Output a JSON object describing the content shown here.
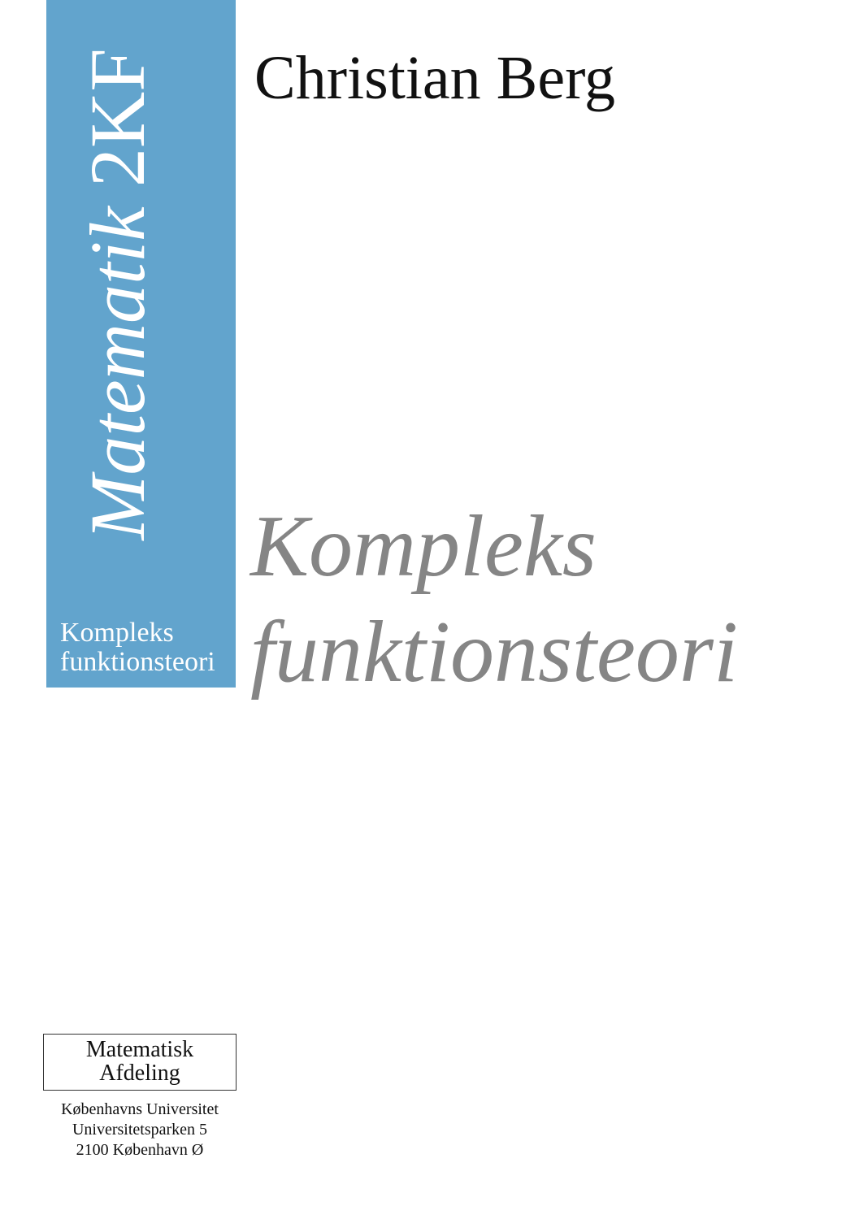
{
  "cover": {
    "series": {
      "italic_part": "Matematik",
      "plain_part": "2KF"
    },
    "band_subtitle": [
      "Kompleks",
      "funktionsteori"
    ],
    "author": "Christian Berg",
    "title": [
      "Kompleks",
      "funktionsteori"
    ],
    "department": [
      "Matematisk",
      "Afdeling"
    ],
    "address": [
      "Københavns Universitet",
      "Universitetsparken 5",
      "2100 København Ø"
    ]
  },
  "colors": {
    "band": "#62a4cd",
    "title": "#858585",
    "text": "#111111"
  }
}
